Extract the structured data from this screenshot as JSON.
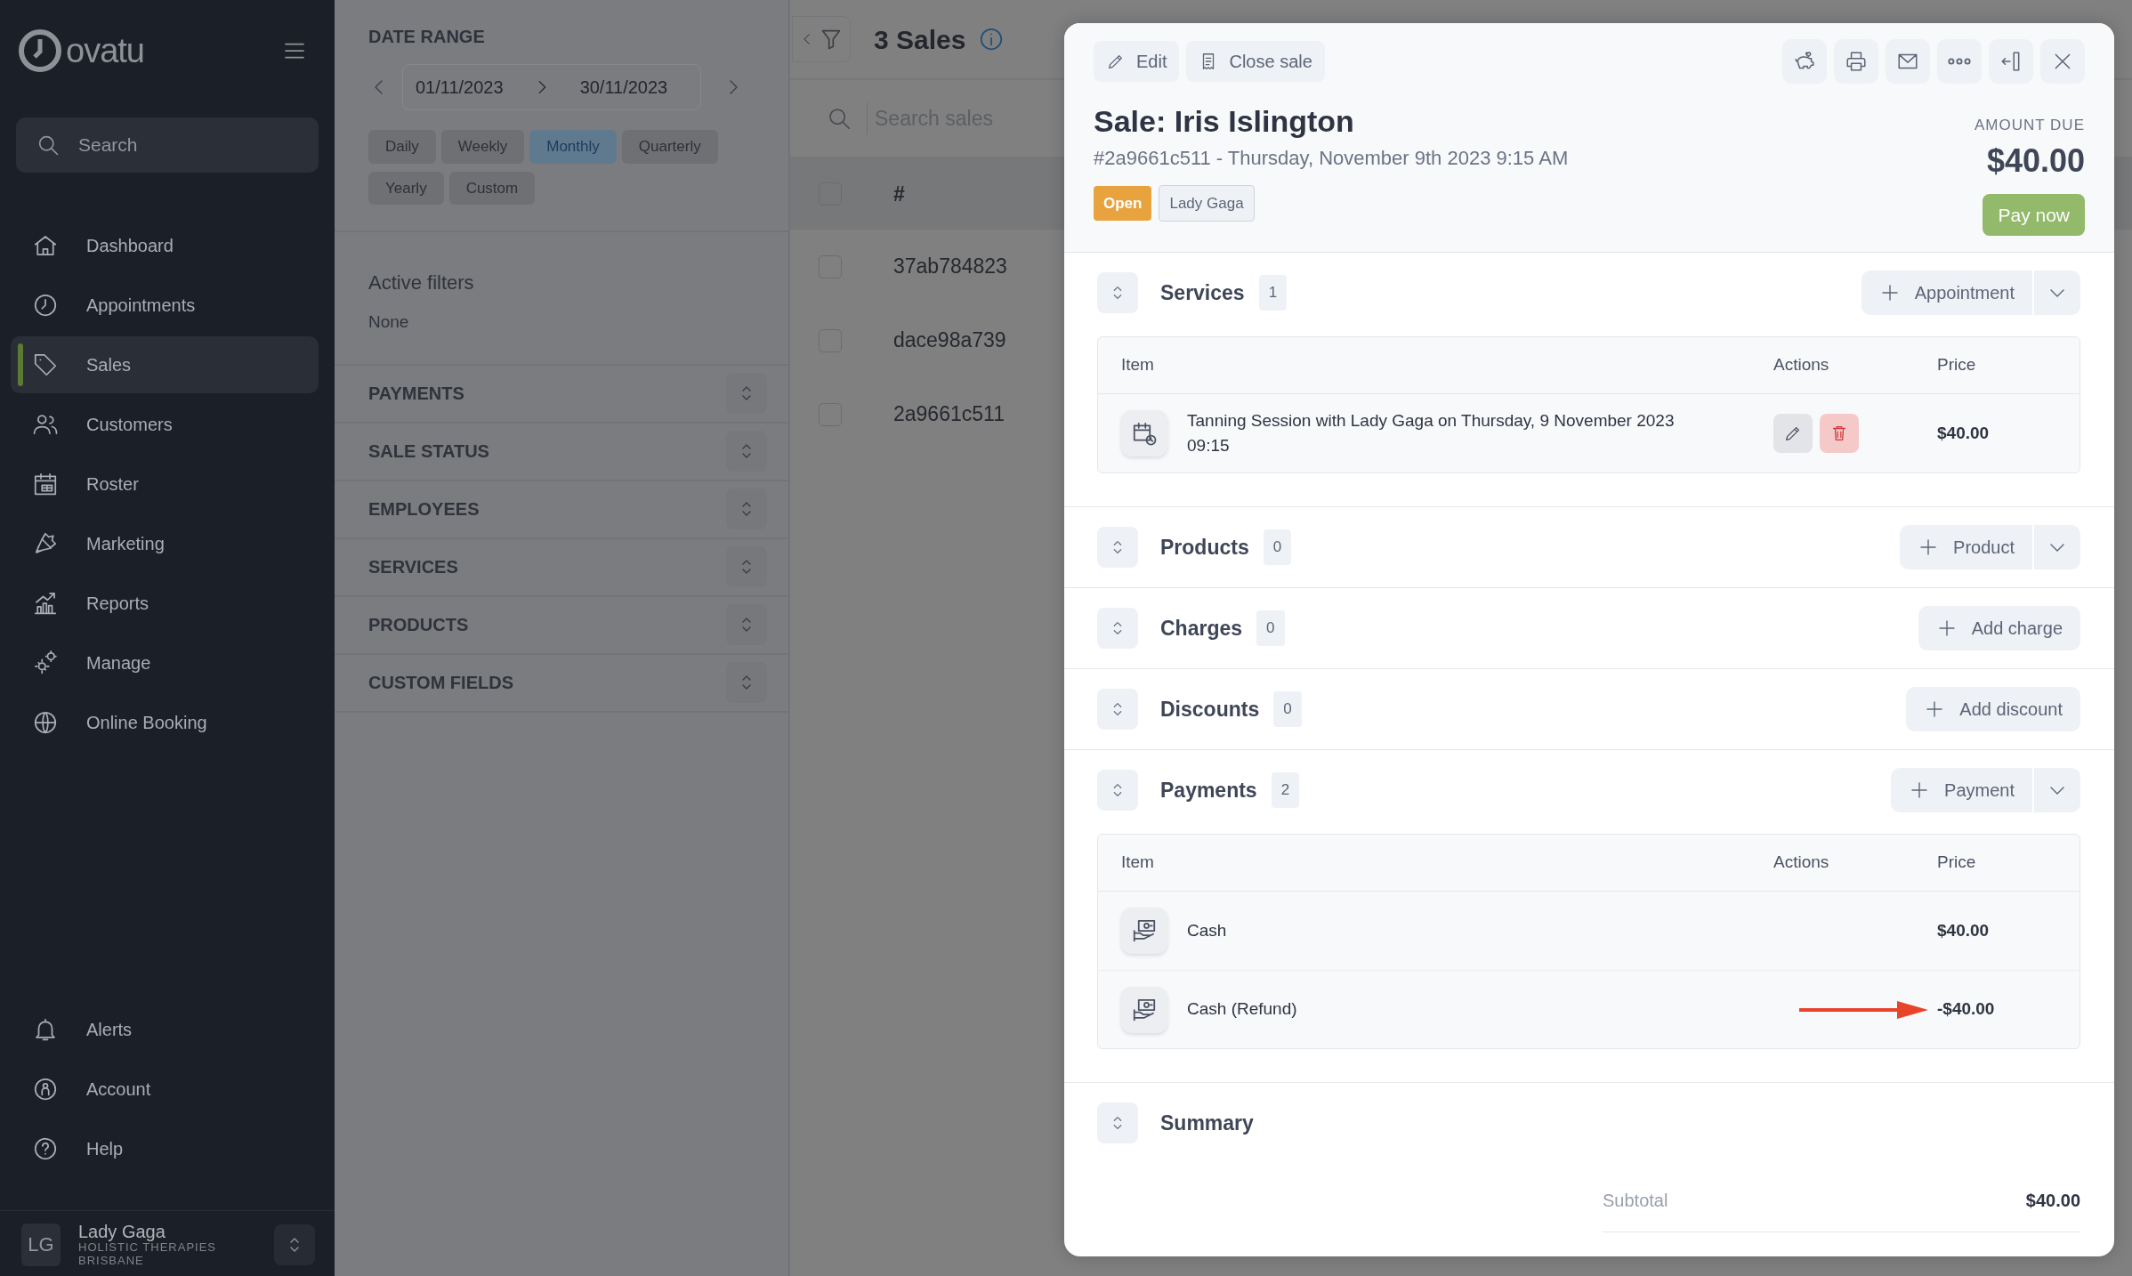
{
  "sidebar": {
    "logo": "ovatu",
    "search": {
      "placeholder": "Search"
    },
    "items": [
      {
        "label": "Dashboard",
        "selected": false
      },
      {
        "label": "Appointments",
        "selected": false
      },
      {
        "label": "Sales",
        "selected": true
      },
      {
        "label": "Customers",
        "selected": false
      },
      {
        "label": "Roster",
        "selected": false
      },
      {
        "label": "Marketing",
        "selected": false
      },
      {
        "label": "Reports",
        "selected": false
      },
      {
        "label": "Manage",
        "selected": false
      },
      {
        "label": "Online Booking",
        "selected": false
      }
    ],
    "bottom_items": [
      {
        "label": "Alerts",
        "selected": false
      },
      {
        "label": "Account",
        "selected": false
      },
      {
        "label": "Help",
        "selected": false
      }
    ],
    "user": {
      "initials": "LG",
      "name": "Lady Gaga",
      "business": "HOLISTIC THERAPIES BRISBANE"
    }
  },
  "filters": {
    "date_range": {
      "title": "DATE RANGE",
      "start": "01/11/2023",
      "end": "30/11/2023"
    },
    "periods": [
      {
        "label": "Daily",
        "selected": false
      },
      {
        "label": "Weekly",
        "selected": false
      },
      {
        "label": "Monthly",
        "selected": true
      },
      {
        "label": "Quarterly",
        "selected": false
      },
      {
        "label": "Yearly",
        "selected": false
      },
      {
        "label": "Custom",
        "selected": false
      }
    ],
    "active_filters": {
      "title": "Active filters",
      "value": "None"
    },
    "groups": [
      "PAYMENTS",
      "SALE STATUS",
      "EMPLOYEES",
      "SERVICES",
      "PRODUCTS",
      "CUSTOM FIELDS"
    ]
  },
  "sales_list": {
    "title": "3 Sales",
    "search": {
      "placeholder": "Search sales"
    },
    "select_all": {
      "checked": false
    },
    "columns": [
      "#"
    ],
    "rows": [
      {
        "id": "37ab784823",
        "checked": false
      },
      {
        "id": "dace98a739",
        "checked": false
      },
      {
        "id": "2a9661c511",
        "checked": false
      }
    ]
  },
  "sale": {
    "toolbar": [
      "Edit",
      "Close sale"
    ],
    "title": "Sale: Iris Islington",
    "subtitle": "#2a9661c511 - Thursday, November 9th 2023 9:15 AM",
    "badges": [
      {
        "label": "Open",
        "kind": "status"
      },
      {
        "label": "Lady Gaga",
        "kind": "employee"
      }
    ],
    "amount_due": {
      "label": "AMOUNT DUE",
      "value": "$40.00"
    },
    "pay_button": "Pay now",
    "sections": [
      {
        "title": "Services",
        "count": "1",
        "action": "Appointment",
        "dropdown": true,
        "table": {
          "columns": [
            "Item",
            "Actions",
            "Price"
          ],
          "rows": [
            {
              "kind": "service",
              "item": "Tanning Session with Lady Gaga on Thursday, 9 November 2023 09:15",
              "editable": true,
              "price": "$40.00",
              "arrow": false
            }
          ]
        }
      },
      {
        "title": "Products",
        "count": "0",
        "action": "Product",
        "dropdown": true
      },
      {
        "title": "Charges",
        "count": "0",
        "action": "Add charge",
        "dropdown": false
      },
      {
        "title": "Discounts",
        "count": "0",
        "action": "Add discount",
        "dropdown": false
      },
      {
        "title": "Payments",
        "count": "2",
        "action": "Payment",
        "dropdown": true,
        "table": {
          "columns": [
            "Item",
            "Actions",
            "Price"
          ],
          "rows": [
            {
              "kind": "payment",
              "item": "Cash",
              "editable": false,
              "price": "$40.00",
              "arrow": false
            },
            {
              "kind": "payment",
              "item": "Cash (Refund)",
              "editable": false,
              "price": "-$40.00",
              "arrow": true
            }
          ]
        }
      }
    ],
    "summary": {
      "title": "Summary",
      "rows": [
        {
          "label": "Subtotal",
          "value": "$40.00"
        }
      ]
    }
  }
}
